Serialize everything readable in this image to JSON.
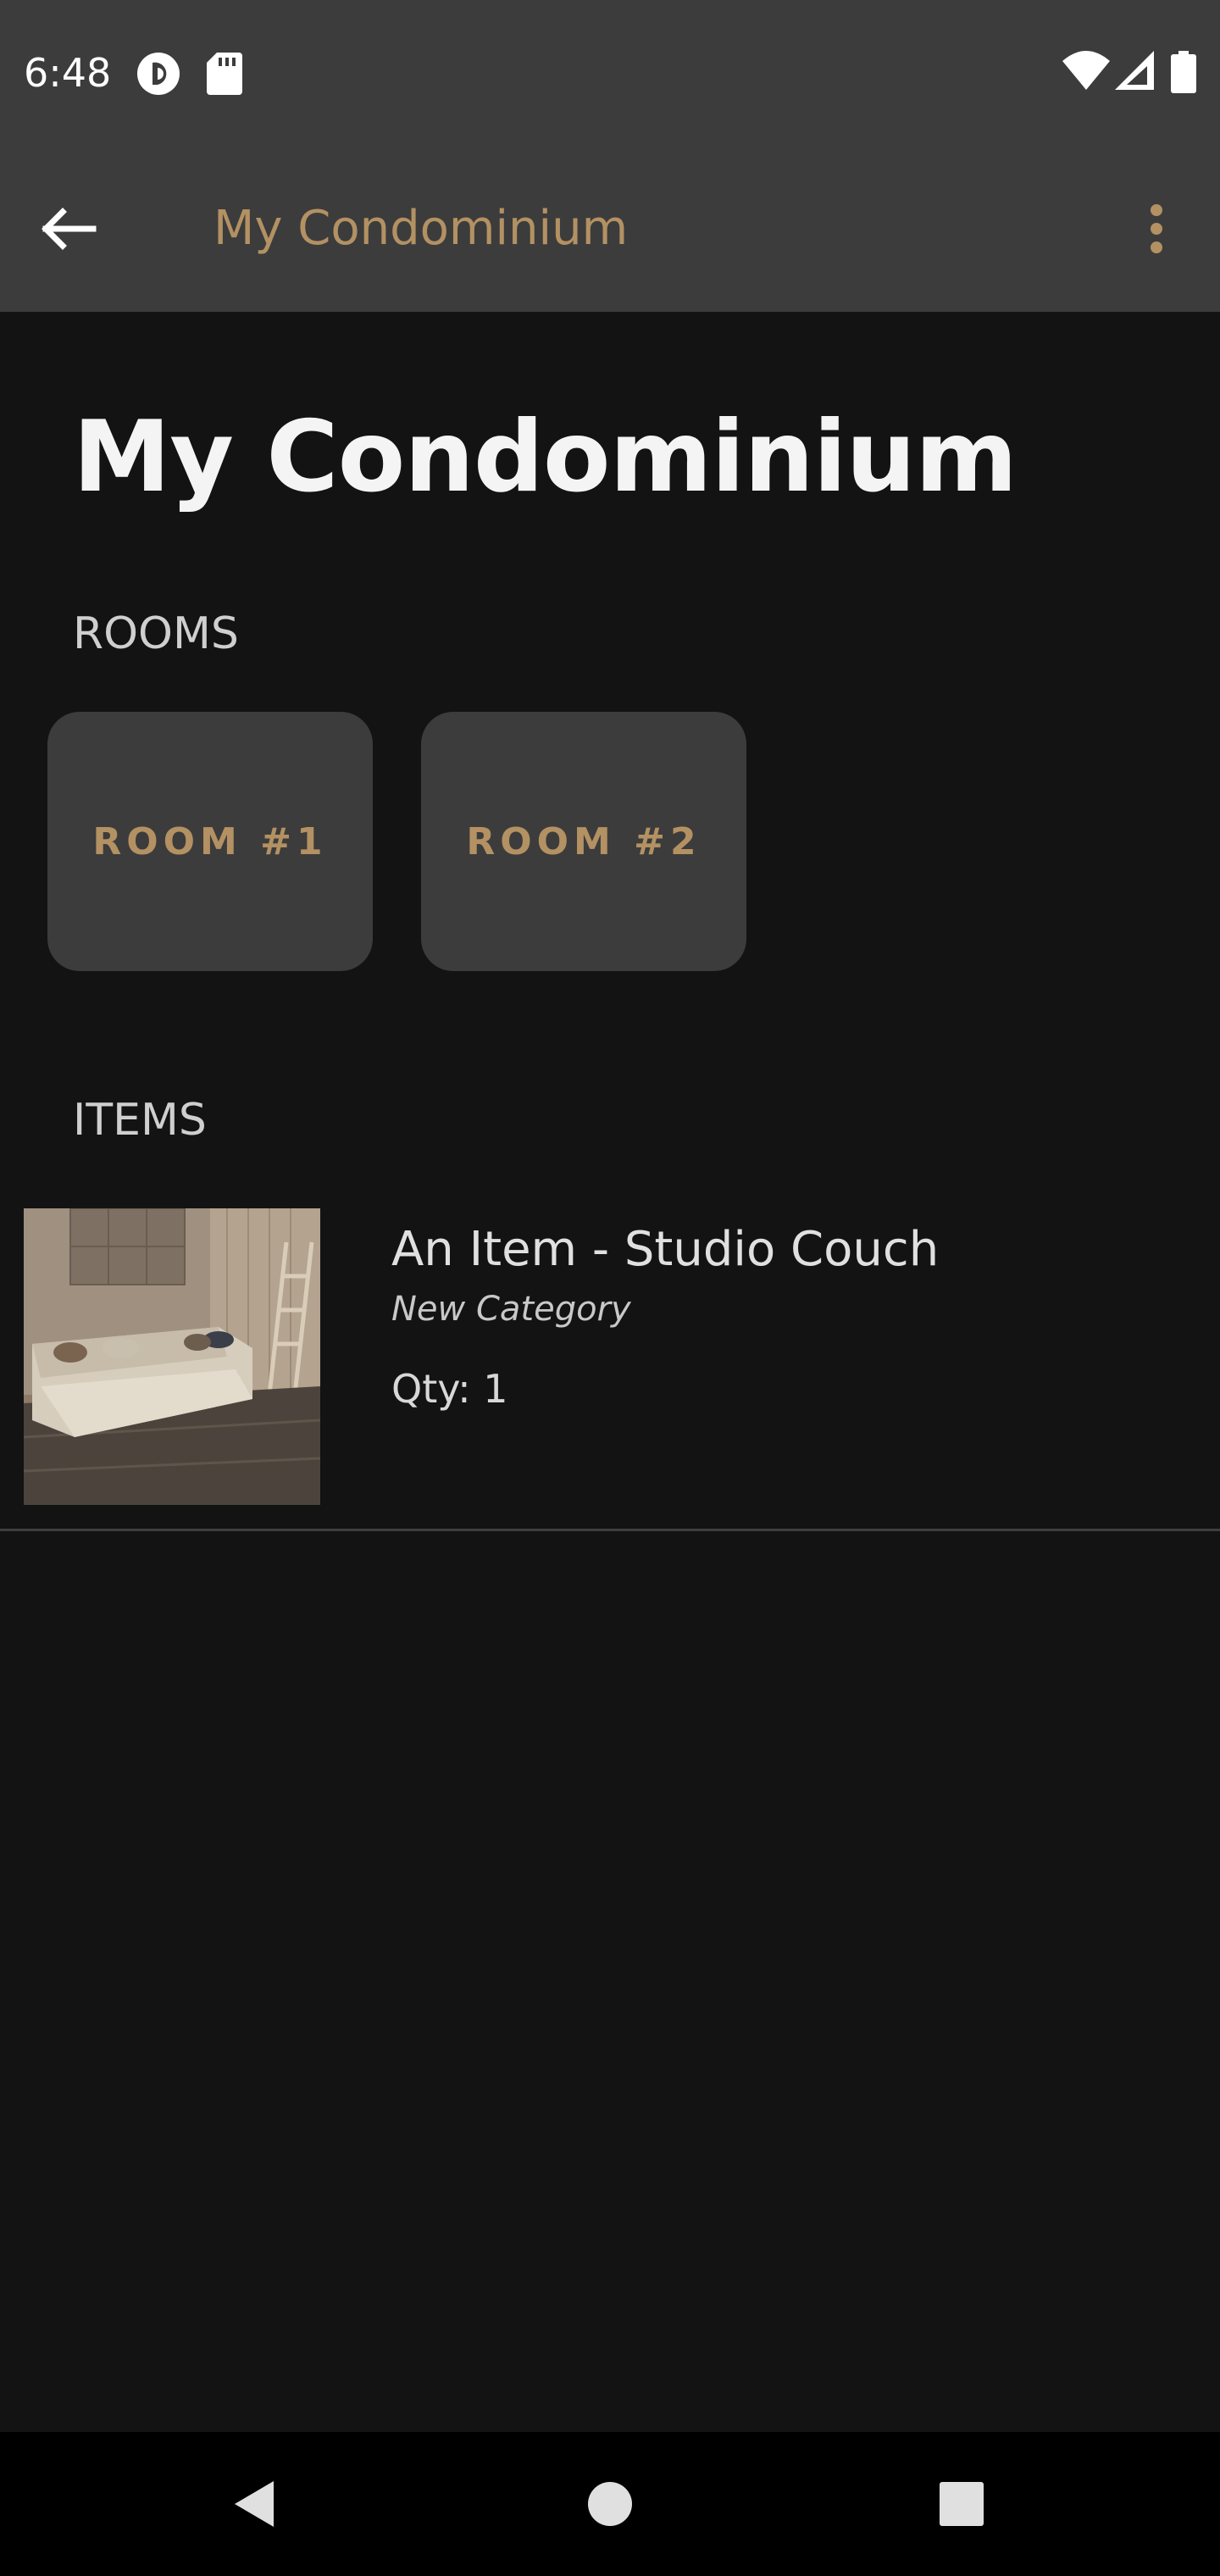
{
  "status_bar": {
    "time": "6:48",
    "icons": [
      "pocket-casts-icon",
      "sd-card-icon",
      "wifi-icon",
      "cellular-signal-icon",
      "battery-icon"
    ]
  },
  "app_bar": {
    "title": "My Condominium",
    "back_icon": "arrow-back-icon",
    "menu_icon": "more-vert-icon"
  },
  "page": {
    "title": "My Condominium"
  },
  "rooms": {
    "label": "ROOMS",
    "items": [
      {
        "label": "ROOM #1"
      },
      {
        "label": "ROOM #2"
      }
    ]
  },
  "items": {
    "label": "ITEMS",
    "list": [
      {
        "name": "An Item - Studio Couch",
        "category": "New Category",
        "qty": "Qty: 1",
        "thumbnail": "couch-photo"
      }
    ]
  },
  "nav_bar": {
    "icons": [
      "nav-back-icon",
      "nav-home-icon",
      "nav-recents-icon"
    ]
  },
  "colors": {
    "background": "#131313",
    "bar": "#3c3c3c",
    "accent": "#b39163"
  }
}
